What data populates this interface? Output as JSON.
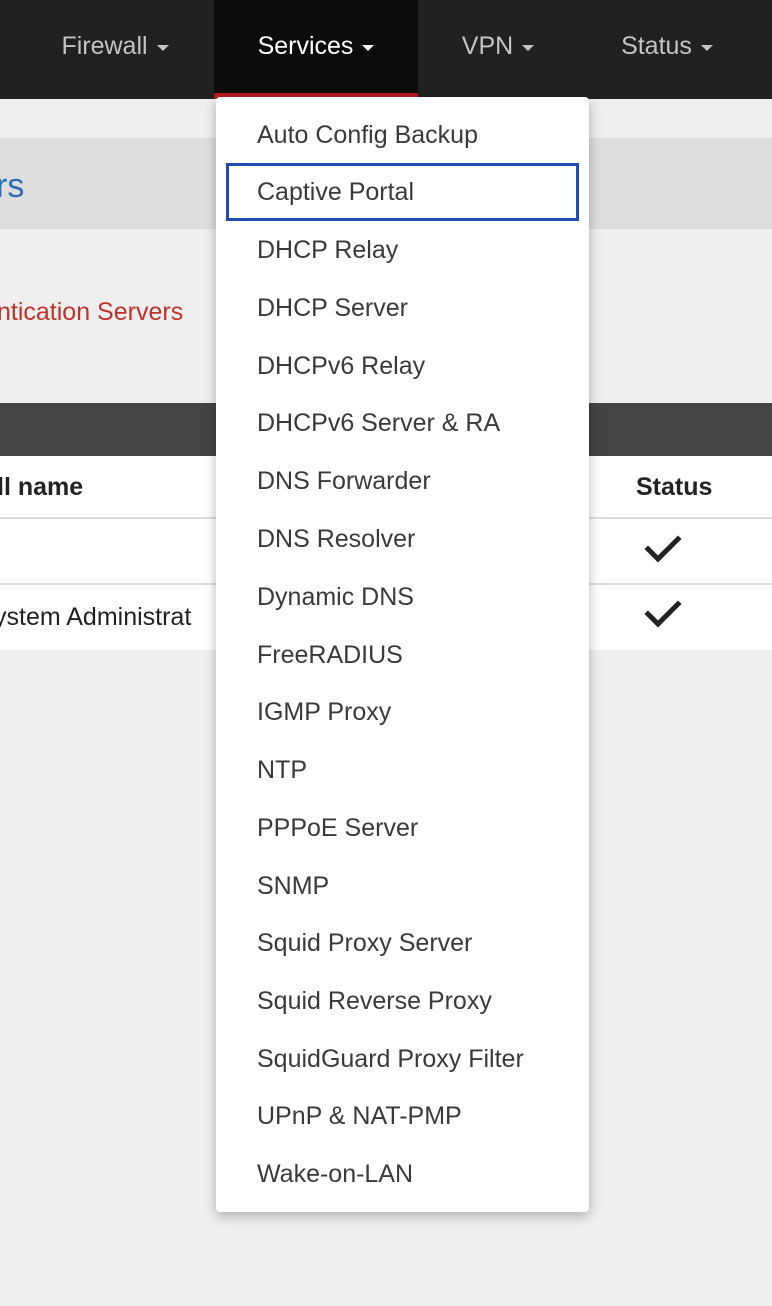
{
  "navbar": {
    "items": [
      {
        "label": "Firewall",
        "icon": "caret-down-icon"
      },
      {
        "label": "Services",
        "icon": "caret-down-icon",
        "active": true
      },
      {
        "label": "VPN",
        "icon": "caret-down-icon"
      },
      {
        "label": "Status",
        "icon": "caret-down-icon"
      }
    ],
    "active_underline_color": "#b41c24"
  },
  "page": {
    "title_fragment": "rs",
    "breadcrumb_fragment": "ntication Servers"
  },
  "table": {
    "headers": {
      "full_name": "ll name",
      "status": "Status"
    },
    "rows": [
      {
        "full_name": "",
        "status_icon": "checkmark-icon"
      },
      {
        "full_name": "ystem Administrat",
        "status_icon": "checkmark-icon"
      }
    ]
  },
  "services_menu": {
    "highlighted_item": "Captive Portal",
    "highlight_color": "#1e4bb5",
    "items": [
      "Auto Config Backup",
      "Captive Portal",
      "DHCP Relay",
      "DHCP Server",
      "DHCPv6 Relay",
      "DHCPv6 Server & RA",
      "DNS Forwarder",
      "DNS Resolver",
      "Dynamic DNS",
      "FreeRADIUS",
      "IGMP Proxy",
      "NTP",
      "PPPoE Server",
      "SNMP",
      "Squid Proxy Server",
      "Squid Reverse Proxy",
      "SquidGuard Proxy Filter",
      "UPnP & NAT-PMP",
      "Wake-on-LAN"
    ]
  }
}
